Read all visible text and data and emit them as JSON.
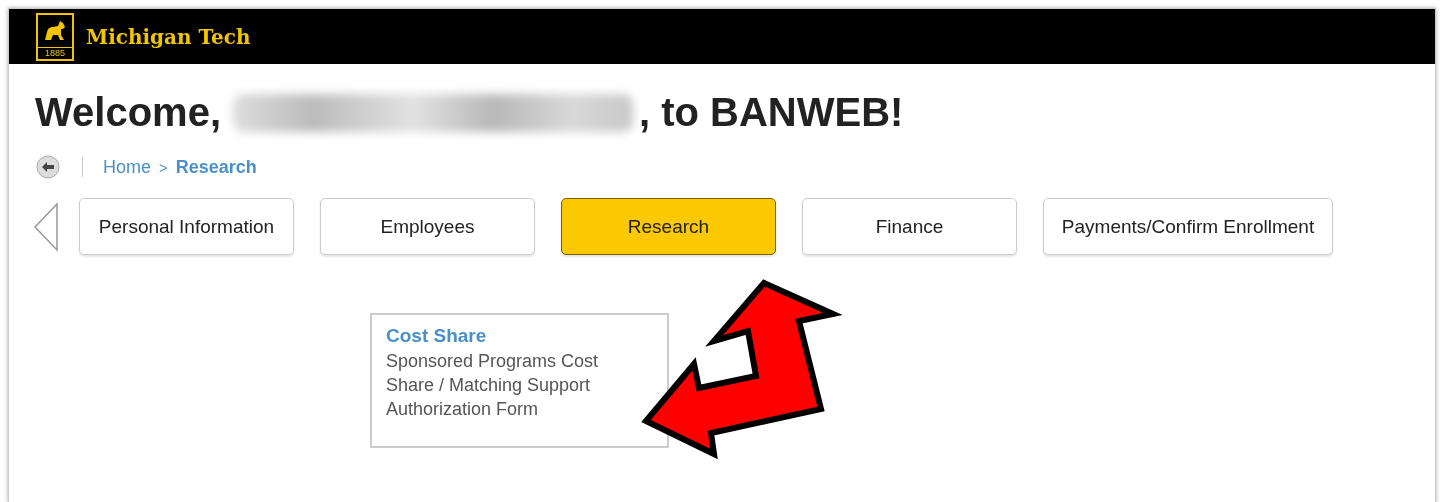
{
  "header": {
    "logo_year": "1885",
    "brand": "Michigan Tech"
  },
  "welcome": {
    "before": "Welcome,",
    "name_redacted": true,
    "after": ", to BANWEB!"
  },
  "breadcrumb": [
    {
      "label": "Home",
      "selected": false
    },
    {
      "label": "Research",
      "selected": true
    }
  ],
  "breadcrumb_separator": ">",
  "tabs": [
    {
      "label": "Personal Information",
      "selected": false
    },
    {
      "label": "Employees",
      "selected": false
    },
    {
      "label": "Research",
      "selected": true
    },
    {
      "label": "Finance",
      "selected": false
    },
    {
      "label": "Payments/Confirm Enrollment",
      "selected": false
    }
  ],
  "cards": [
    {
      "title": "Cost Share",
      "description": "Sponsored Programs Cost Share / Matching Support Authorization Form"
    }
  ],
  "annotation": {
    "kind": "double-arrow"
  }
}
